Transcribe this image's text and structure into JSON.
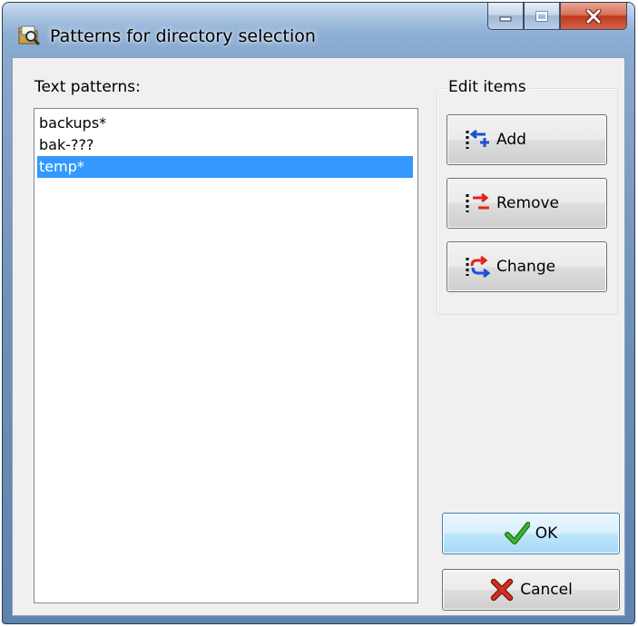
{
  "window": {
    "title": "Patterns for directory selection",
    "icon": "folder-search-icon"
  },
  "caption_buttons": [
    {
      "name": "minimize",
      "icon": "minimize-icon"
    },
    {
      "name": "maximize",
      "icon": "maximize-icon"
    },
    {
      "name": "close",
      "icon": "close-icon"
    }
  ],
  "patterns": {
    "label": "Text patterns:",
    "items": [
      "backups*",
      "bak-???",
      "temp*"
    ],
    "selected_index": 2
  },
  "edit_items": {
    "legend": "Edit items",
    "add_label": "Add",
    "remove_label": "Remove",
    "change_label": "Change"
  },
  "dialog_buttons": {
    "ok_label": "OK",
    "cancel_label": "Cancel"
  },
  "colors": {
    "selection": "#3399ff",
    "ok_check": "#2e9a1e",
    "cancel_x": "#c0281c",
    "arrow_blue": "#1d4fd8",
    "arrow_red": "#e2231a"
  }
}
